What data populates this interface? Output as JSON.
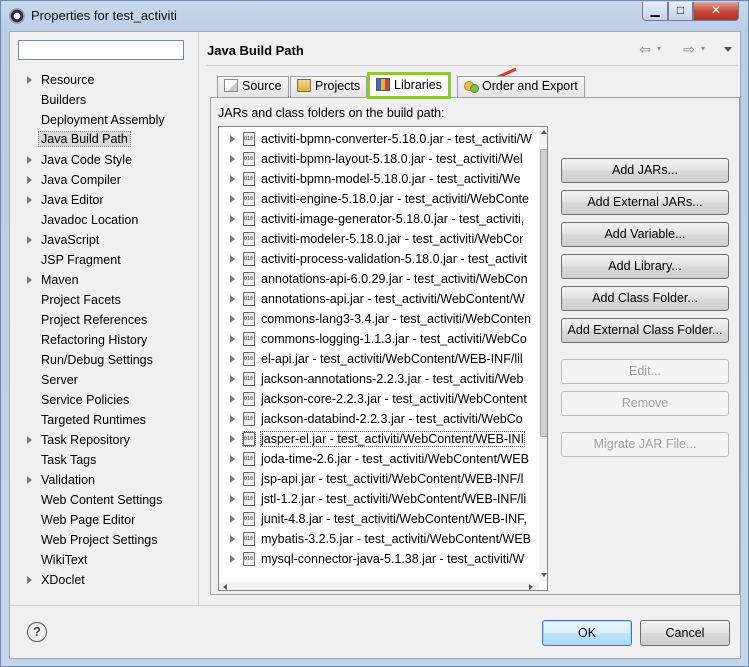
{
  "window": {
    "title": "Properties for test_activiti"
  },
  "filter": {
    "value": ""
  },
  "nav": {
    "items": [
      {
        "label": "Resource",
        "expandable": true
      },
      {
        "label": "Builders",
        "expandable": false
      },
      {
        "label": "Deployment Assembly",
        "expandable": false
      },
      {
        "label": "Java Build Path",
        "expandable": false,
        "selected": true
      },
      {
        "label": "Java Code Style",
        "expandable": true
      },
      {
        "label": "Java Compiler",
        "expandable": true
      },
      {
        "label": "Java Editor",
        "expandable": true
      },
      {
        "label": "Javadoc Location",
        "expandable": false
      },
      {
        "label": "JavaScript",
        "expandable": true
      },
      {
        "label": "JSP Fragment",
        "expandable": false
      },
      {
        "label": "Maven",
        "expandable": true
      },
      {
        "label": "Project Facets",
        "expandable": false
      },
      {
        "label": "Project References",
        "expandable": false
      },
      {
        "label": "Refactoring History",
        "expandable": false
      },
      {
        "label": "Run/Debug Settings",
        "expandable": false
      },
      {
        "label": "Server",
        "expandable": false
      },
      {
        "label": "Service Policies",
        "expandable": false
      },
      {
        "label": "Targeted Runtimes",
        "expandable": false
      },
      {
        "label": "Task Repository",
        "expandable": true
      },
      {
        "label": "Task Tags",
        "expandable": false
      },
      {
        "label": "Validation",
        "expandable": true
      },
      {
        "label": "Web Content Settings",
        "expandable": false
      },
      {
        "label": "Web Page Editor",
        "expandable": false
      },
      {
        "label": "Web Project Settings",
        "expandable": false
      },
      {
        "label": "WikiText",
        "expandable": false
      },
      {
        "label": "XDoclet",
        "expandable": true
      }
    ]
  },
  "page": {
    "title": "Java Build Path"
  },
  "tabs": [
    {
      "label": "Source",
      "icon": "source-folder-icon"
    },
    {
      "label": "Projects",
      "icon": "projects-icon"
    },
    {
      "label": "Libraries",
      "icon": "libraries-icon",
      "active": true
    },
    {
      "label": "Order and Export",
      "icon": "order-export-icon"
    }
  ],
  "libraries": {
    "heading": "JARs and class folders on the build path:",
    "jars": [
      "activiti-bpmn-converter-5.18.0.jar - test_activiti/W",
      "activiti-bpmn-layout-5.18.0.jar - test_activiti/Wel",
      "activiti-bpmn-model-5.18.0.jar - test_activiti/We",
      "activiti-engine-5.18.0.jar - test_activiti/WebConte",
      "activiti-image-generator-5.18.0.jar - test_activiti,",
      "activiti-modeler-5.18.0.jar - test_activiti/WebCor",
      "activiti-process-validation-5.18.0.jar - test_activit",
      "annotations-api-6.0.29.jar - test_activiti/WebCon",
      "annotations-api.jar - test_activiti/WebContent/W",
      "commons-lang3-3.4.jar - test_activiti/WebConten",
      "commons-logging-1.1.3.jar - test_activiti/WebCo",
      "el-api.jar - test_activiti/WebContent/WEB-INF/lil",
      "jackson-annotations-2.2.3.jar - test_activiti/Web",
      "jackson-core-2.2.3.jar - test_activiti/WebContent",
      "jackson-databind-2.2.3.jar - test_activiti/WebCo",
      "jasper-el.jar - test_activiti/WebContent/WEB-INI",
      "joda-time-2.6.jar - test_activiti/WebContent/WEB",
      "jsp-api.jar - test_activiti/WebContent/WEB-INF/l",
      "jstl-1.2.jar - test_activiti/WebContent/WEB-INF/li",
      "junit-4.8.jar - test_activiti/WebContent/WEB-INF,",
      "mybatis-3.2.5.jar - test_activiti/WebContent/WEB",
      "mysql-connector-java-5.1.38.jar - test_activiti/W"
    ],
    "focused_index": 15
  },
  "buttons": {
    "add_jars": "Add JARs...",
    "add_external_jars": "Add External JARs...",
    "add_variable": "Add Variable...",
    "add_library": "Add Library...",
    "add_class_folder": "Add Class Folder...",
    "add_external_class_folder": "Add External Class Folder...",
    "edit": "Edit...",
    "remove": "Remove",
    "migrate_jar": "Migrate JAR File..."
  },
  "dialog": {
    "ok": "OK",
    "cancel": "Cancel",
    "help": "?"
  },
  "colors": {
    "highlight": "#8cc83c",
    "annotation_arrow": "#e8312a"
  }
}
